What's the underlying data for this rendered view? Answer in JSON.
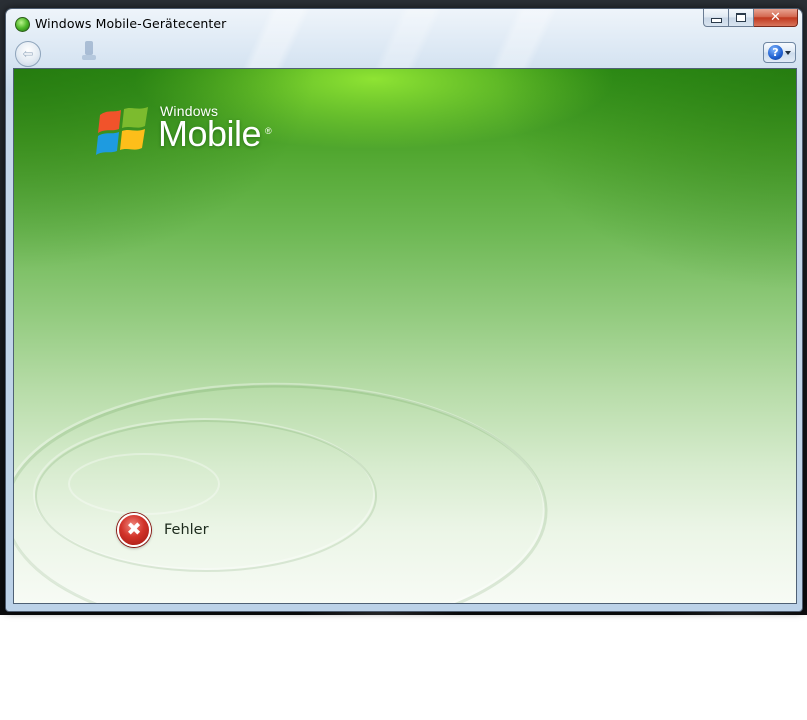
{
  "window": {
    "title": "Windows Mobile-Gerätecenter"
  },
  "caption_buttons": {
    "minimize_icon": "minimize-icon",
    "maximize_icon": "maximize-icon",
    "close_glyph": "✕"
  },
  "toolbar": {
    "back_glyph": "⇦",
    "help_glyph": "?"
  },
  "logo": {
    "brand_small": "Windows",
    "brand_big": "Mobile",
    "registered": "®"
  },
  "status": {
    "error_glyph": "✖",
    "error_text": "Fehler"
  },
  "colors": {
    "accent_green": "#4ea52c",
    "error_red": "#d2332a"
  }
}
